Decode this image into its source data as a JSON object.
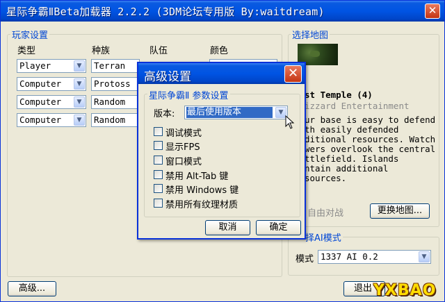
{
  "window": {
    "title": "星际争霸ⅡBeta加载器 2.2.2 (3DM论坛专用版 By:waitdream)",
    "close_glyph": "✕"
  },
  "players": {
    "group_label": "玩家设置",
    "headers": [
      "类型",
      "种族",
      "队伍",
      "颜色"
    ],
    "rows": [
      {
        "type": "Player",
        "race": "Terran"
      },
      {
        "type": "Computer",
        "race": "Protoss"
      },
      {
        "type": "Computer",
        "race": "Random"
      },
      {
        "type": "Computer",
        "race": "Random"
      }
    ]
  },
  "map": {
    "group_label": "选择地图",
    "name_partial": "st Temple (4)",
    "author_partial": "izzard Entertainment",
    "description_lines": [
      "ur base is easy to defend",
      "th easily defended",
      "ditional resources. Watch",
      "wers overlook the central",
      "ttlefield. Islands",
      "ntain additional",
      "sources."
    ],
    "free_battle_partial": "自由对战",
    "change_map_button": "更换地图..."
  },
  "ai": {
    "group_label_partial": "择AI模式",
    "mode_label": "模式",
    "mode_value": "1337 AI 0.2"
  },
  "advanced_button": "高级...",
  "exit_button_partial": "退出",
  "dialog": {
    "title": "高级设置",
    "close_glyph": "✕",
    "group_label": "星际争霸Ⅱ 参数设置",
    "version_label": "版本:",
    "version_value": "最后使用版本",
    "checkboxes": [
      "调试模式",
      "显示FPS",
      "窗口模式",
      "禁用 Alt-Tab 键",
      "禁用 Windows 键",
      "禁用所有纹理材质"
    ],
    "cancel_button": "取消",
    "ok_button": "确定"
  },
  "watermark": "YXBAO",
  "icons": {
    "dropdown": "chevron-down-icon",
    "close": "close-icon",
    "cursor": "mouse-pointer-icon"
  },
  "colors": {
    "titlebar": "#0054e3",
    "group_label": "#0046d5",
    "selection": "#316ac5",
    "close": "#c43412"
  }
}
